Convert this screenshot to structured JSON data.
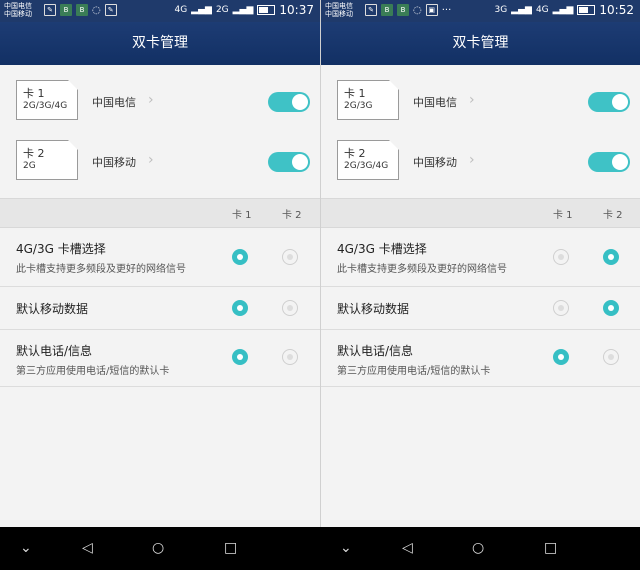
{
  "left": {
    "status": {
      "carrier1": "中国电信",
      "carrier2": "中国移动",
      "net": "4G",
      "net2": "2G",
      "time": "10:37"
    },
    "title": "双卡管理",
    "sims": [
      {
        "name": "卡 1",
        "type": "2G/3G/4G",
        "operator": "中国电信",
        "enabled": true
      },
      {
        "name": "卡 2",
        "type": "2G",
        "operator": "中国移动",
        "enabled": true
      }
    ],
    "cols": [
      "卡 1",
      "卡 2"
    ],
    "rows": [
      {
        "title": "4G/3G 卡槽选择",
        "sub": "此卡槽支持更多频段及更好的网络信号",
        "selected": 1
      },
      {
        "title": "默认移动数据",
        "sub": "",
        "selected": 1
      },
      {
        "title": "默认电话/信息",
        "sub": "第三方应用使用电话/短信的默认卡",
        "selected": 1
      }
    ]
  },
  "right": {
    "status": {
      "carrier1": "中国电信",
      "carrier2": "中国移动",
      "net": "4G",
      "net2": "3G",
      "time": "10:52"
    },
    "title": "双卡管理",
    "sims": [
      {
        "name": "卡 1",
        "type": "2G/3G",
        "operator": "中国电信",
        "enabled": true
      },
      {
        "name": "卡 2",
        "type": "2G/3G/4G",
        "operator": "中国移动",
        "enabled": true
      }
    ],
    "cols": [
      "卡 1",
      "卡 2"
    ],
    "rows": [
      {
        "title": "4G/3G 卡槽选择",
        "sub": "此卡槽支持更多频段及更好的网络信号",
        "selected": 2
      },
      {
        "title": "默认移动数据",
        "sub": "",
        "selected": 2
      },
      {
        "title": "默认电话/信息",
        "sub": "第三方应用使用电话/短信的默认卡",
        "selected": 1
      }
    ]
  },
  "nav": {
    "down": "⌄",
    "back": "◁",
    "home": "○",
    "recent": "□"
  }
}
